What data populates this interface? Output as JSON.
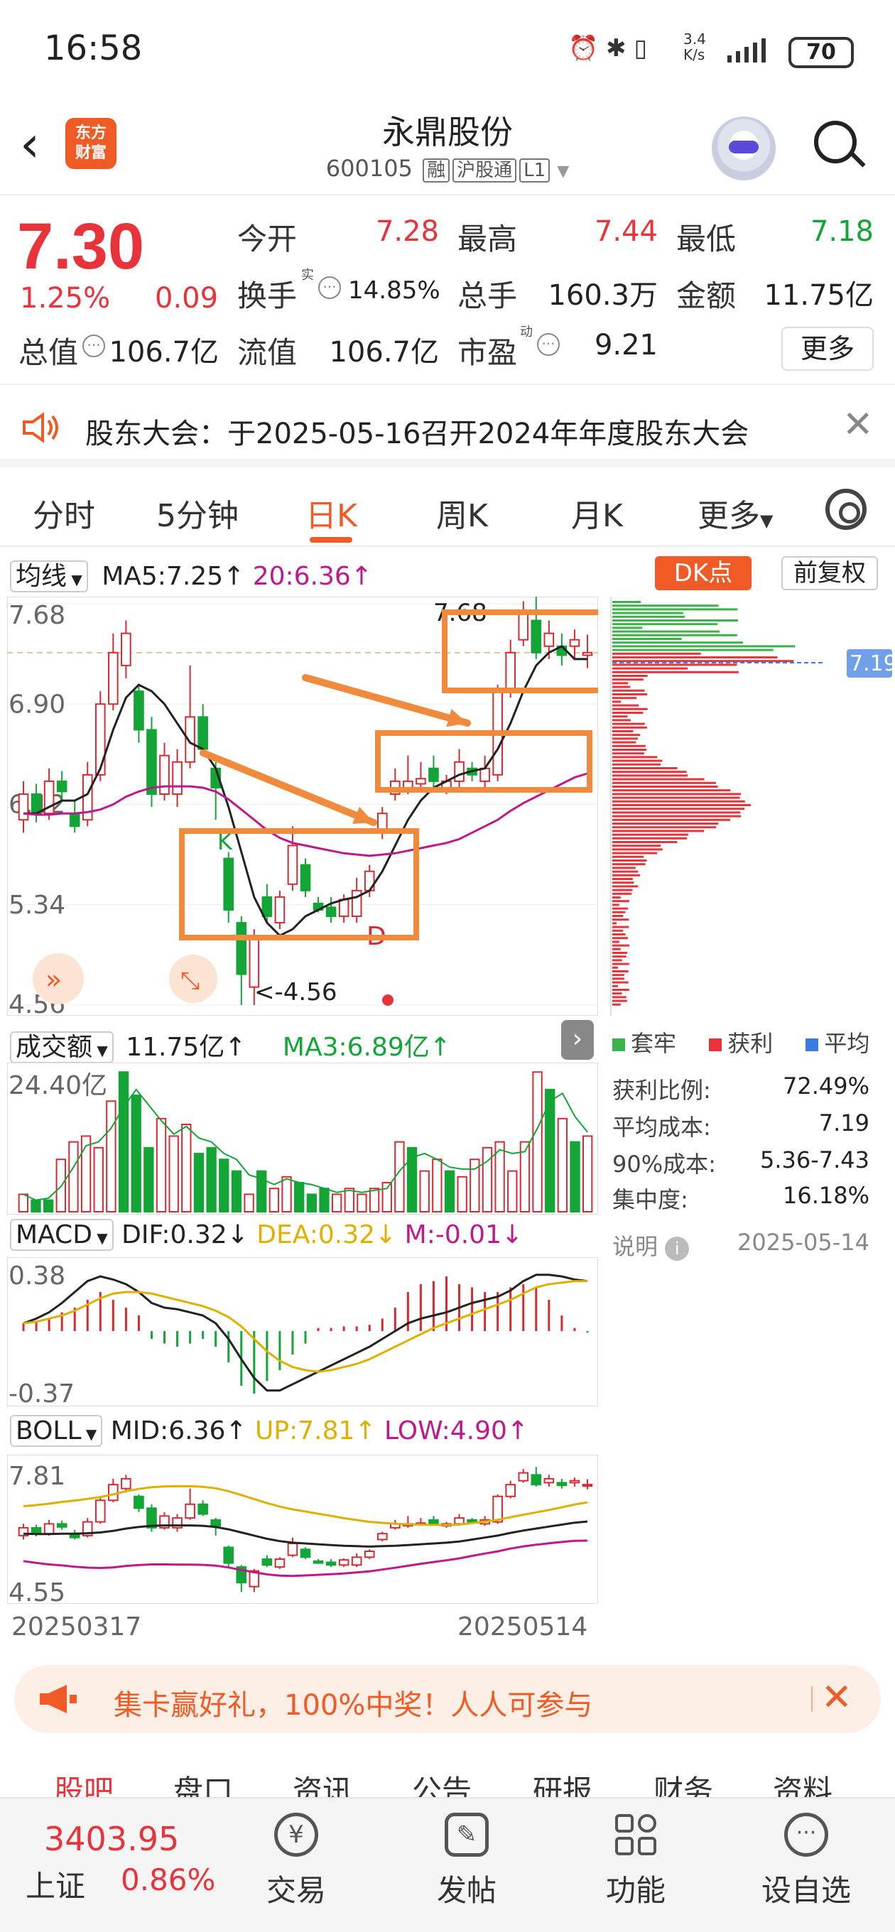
{
  "status_bar": {
    "time": "16:58",
    "net_speed": "3.4\nK/s",
    "battery": "70"
  },
  "header": {
    "logo_text": "东方\n财富",
    "stock_name": "永鼎股份",
    "stock_code": "600105",
    "tags": [
      "融",
      "沪股通",
      "L1"
    ]
  },
  "quote": {
    "price": "7.30",
    "change_pct": "1.25%",
    "change_val": "0.09",
    "fields": [
      {
        "label": "今开",
        "value": "7.28",
        "color": "#e8333a"
      },
      {
        "label": "最高",
        "value": "7.44",
        "color": "#e8333a"
      },
      {
        "label": "最低",
        "value": "7.18",
        "color": "#13a536"
      },
      {
        "label": "换手",
        "value": "14.85%",
        "color": "#222222",
        "sup": "实"
      },
      {
        "label": "总手",
        "value": "160.3万",
        "color": "#222222"
      },
      {
        "label": "金额",
        "value": "11.75亿",
        "color": "#222222"
      },
      {
        "label": "总值",
        "value": "106.7亿",
        "color": "#222222"
      },
      {
        "label": "流值",
        "value": "106.7亿",
        "color": "#222222"
      },
      {
        "label": "市盈",
        "value": "9.21",
        "color": "#222222",
        "sup": "动"
      }
    ],
    "more_label": "更多"
  },
  "notice": {
    "text": "股东大会：于2025-05-16召开2024年年度股东大会"
  },
  "tabs": [
    "分时",
    "5分钟",
    "日K",
    "周K",
    "月K",
    "更多"
  ],
  "active_tab": "日K",
  "kline_header": {
    "ma_dropdown": "均线",
    "ma5": "MA5:7.25↑",
    "ma20": "20:6.36↑",
    "dk_label": "DK点",
    "fuquan_label": "前复权"
  },
  "chart_data": [
    {
      "type": "candlestick",
      "title": "日K",
      "y_ticks": [
        "7.68",
        "6.90",
        "6.12",
        "5.34",
        "4.56"
      ],
      "ylim": [
        4.56,
        7.68
      ],
      "annotations": [
        "7.68",
        "<-4.56",
        "K",
        "D"
      ],
      "current_price_label": "7.19",
      "dates": [
        "20250317",
        "20250514"
      ],
      "candles": [
        {
          "o": 6.0,
          "c": 6.2,
          "h": 6.3,
          "l": 5.9,
          "up": true
        },
        {
          "o": 6.2,
          "c": 6.05,
          "h": 6.28,
          "l": 5.98,
          "up": false
        },
        {
          "o": 6.05,
          "c": 6.3,
          "h": 6.4,
          "l": 6.0,
          "up": true
        },
        {
          "o": 6.3,
          "c": 6.22,
          "h": 6.38,
          "l": 6.15,
          "up": false
        },
        {
          "o": 6.05,
          "c": 5.95,
          "h": 6.15,
          "l": 5.9,
          "up": false
        },
        {
          "o": 6.0,
          "c": 6.35,
          "h": 6.45,
          "l": 5.95,
          "up": true
        },
        {
          "o": 6.35,
          "c": 6.9,
          "h": 7.0,
          "l": 6.3,
          "up": true
        },
        {
          "o": 6.9,
          "c": 7.3,
          "h": 7.45,
          "l": 6.85,
          "up": true
        },
        {
          "o": 7.2,
          "c": 7.45,
          "h": 7.55,
          "l": 7.1,
          "up": true
        },
        {
          "o": 7.0,
          "c": 6.7,
          "h": 7.05,
          "l": 6.6,
          "up": false
        },
        {
          "o": 6.7,
          "c": 6.2,
          "h": 6.8,
          "l": 6.1,
          "up": false
        },
        {
          "o": 6.2,
          "c": 6.5,
          "h": 6.6,
          "l": 6.15,
          "up": true
        },
        {
          "o": 6.2,
          "c": 6.45,
          "h": 6.55,
          "l": 6.1,
          "up": true
        },
        {
          "o": 6.45,
          "c": 6.8,
          "h": 7.2,
          "l": 6.4,
          "up": true
        },
        {
          "o": 6.8,
          "c": 6.55,
          "h": 6.9,
          "l": 6.5,
          "up": false
        },
        {
          "o": 6.4,
          "c": 6.25,
          "h": 6.45,
          "l": 6.0,
          "up": false
        },
        {
          "o": 5.7,
          "c": 5.3,
          "h": 5.75,
          "l": 5.2,
          "up": false
        },
        {
          "o": 5.2,
          "c": 4.8,
          "h": 5.25,
          "l": 4.56,
          "up": false
        },
        {
          "o": 4.7,
          "c": 5.1,
          "h": 5.15,
          "l": 4.56,
          "up": true
        },
        {
          "o": 5.25,
          "c": 5.4,
          "h": 5.5,
          "l": 5.2,
          "up": false
        },
        {
          "o": 5.2,
          "c": 5.4,
          "h": 5.45,
          "l": 5.15,
          "up": true
        },
        {
          "o": 5.5,
          "c": 5.8,
          "h": 5.95,
          "l": 5.45,
          "up": true
        },
        {
          "o": 5.65,
          "c": 5.45,
          "h": 5.7,
          "l": 5.4,
          "up": false
        },
        {
          "o": 5.35,
          "c": 5.3,
          "h": 5.4,
          "l": 5.28,
          "up": false
        },
        {
          "o": 5.32,
          "c": 5.25,
          "h": 5.4,
          "l": 5.2,
          "up": false
        },
        {
          "o": 5.25,
          "c": 5.38,
          "h": 5.42,
          "l": 5.2,
          "up": true
        },
        {
          "o": 5.25,
          "c": 5.45,
          "h": 5.55,
          "l": 5.2,
          "up": true
        },
        {
          "o": 5.45,
          "c": 5.6,
          "h": 5.65,
          "l": 5.4,
          "up": true
        },
        {
          "o": 5.9,
          "c": 6.05,
          "h": 6.1,
          "l": 5.85,
          "up": true
        },
        {
          "o": 6.2,
          "c": 6.3,
          "h": 6.4,
          "l": 6.15,
          "up": true
        },
        {
          "o": 6.25,
          "c": 6.3,
          "h": 6.5,
          "l": 6.2,
          "up": true
        },
        {
          "o": 6.28,
          "c": 6.32,
          "h": 6.45,
          "l": 6.25,
          "up": true
        },
        {
          "o": 6.4,
          "c": 6.3,
          "h": 6.5,
          "l": 6.25,
          "up": false
        },
        {
          "o": 6.25,
          "c": 6.3,
          "h": 6.35,
          "l": 6.2,
          "up": true
        },
        {
          "o": 6.3,
          "c": 6.45,
          "h": 6.55,
          "l": 6.25,
          "up": true
        },
        {
          "o": 6.4,
          "c": 6.35,
          "h": 6.45,
          "l": 6.3,
          "up": false
        },
        {
          "o": 6.3,
          "c": 6.4,
          "h": 6.5,
          "l": 6.25,
          "up": true
        },
        {
          "o": 6.35,
          "c": 7.0,
          "h": 7.05,
          "l": 6.3,
          "up": true
        },
        {
          "o": 7.0,
          "c": 7.3,
          "h": 7.4,
          "l": 6.95,
          "up": true
        },
        {
          "o": 7.4,
          "c": 7.6,
          "h": 7.7,
          "l": 7.35,
          "up": true
        },
        {
          "o": 7.55,
          "c": 7.3,
          "h": 7.75,
          "l": 7.25,
          "up": false
        },
        {
          "o": 7.35,
          "c": 7.45,
          "h": 7.55,
          "l": 7.25,
          "up": true
        },
        {
          "o": 7.35,
          "c": 7.28,
          "h": 7.45,
          "l": 7.2,
          "up": false
        },
        {
          "o": 7.35,
          "c": 7.4,
          "h": 7.48,
          "l": 7.25,
          "up": true
        },
        {
          "o": 7.28,
          "c": 7.3,
          "h": 7.44,
          "l": 7.18,
          "up": true
        }
      ],
      "ma5": [
        6.05,
        6.05,
        6.1,
        6.15,
        6.15,
        6.2,
        6.4,
        6.7,
        6.95,
        7.05,
        7.0,
        6.9,
        6.75,
        6.6,
        6.55,
        6.4,
        6.1,
        5.75,
        5.4,
        5.2,
        5.1,
        5.15,
        5.25,
        5.3,
        5.35,
        5.38,
        5.4,
        5.45,
        5.6,
        5.8,
        6.0,
        6.15,
        6.25,
        6.3,
        6.35,
        6.38,
        6.4,
        6.55,
        6.75,
        7.0,
        7.2,
        7.3,
        7.35,
        7.25,
        7.25
      ],
      "ma20": [
        6.05,
        6.04,
        6.04,
        6.05,
        6.05,
        6.06,
        6.08,
        6.12,
        6.18,
        6.22,
        6.25,
        6.26,
        6.26,
        6.26,
        6.25,
        6.22,
        6.16,
        6.08,
        6.0,
        5.92,
        5.86,
        5.82,
        5.8,
        5.78,
        5.76,
        5.74,
        5.73,
        5.72,
        5.73,
        5.74,
        5.76,
        5.78,
        5.8,
        5.82,
        5.85,
        5.9,
        5.95,
        6.0,
        6.07,
        6.13,
        6.18,
        6.23,
        6.28,
        6.33,
        6.36
      ]
    },
    {
      "type": "bar",
      "title": "成交额",
      "value_label": "11.75亿↑",
      "ma3_label": "MA3:6.89亿↑",
      "y_tick": "24.40亿",
      "values": [
        3,
        2,
        2,
        9,
        12,
        13,
        11,
        19,
        24,
        20,
        11,
        16,
        13,
        15,
        10,
        11,
        9,
        7,
        3,
        7,
        4,
        6,
        5,
        3,
        4,
        3,
        4,
        3,
        4,
        5,
        12,
        11,
        7,
        9,
        7,
        6,
        9,
        11,
        12,
        7,
        12,
        24,
        21,
        16,
        12,
        13
      ],
      "up": [
        true,
        false,
        false,
        true,
        true,
        true,
        true,
        true,
        false,
        false,
        false,
        true,
        true,
        true,
        false,
        false,
        false,
        false,
        true,
        false,
        true,
        true,
        false,
        false,
        false,
        true,
        true,
        true,
        true,
        true,
        true,
        false,
        true,
        true,
        false,
        true,
        true,
        true,
        true,
        true,
        true,
        true,
        false,
        true,
        false,
        true
      ]
    },
    {
      "type": "bar",
      "title": "MACD",
      "dif_label": "DIF:0.32↓",
      "dea_label": "DEA:0.32↓",
      "m_label": "M:-0.01↓",
      "y_ticks": [
        "0.38",
        "-0.37"
      ],
      "hist": [
        0.05,
        0.06,
        0.08,
        0.12,
        0.15,
        0.2,
        0.25,
        0.2,
        0.15,
        0.1,
        -0.05,
        -0.08,
        -0.1,
        -0.08,
        -0.05,
        -0.1,
        -0.2,
        -0.35,
        -0.4,
        -0.32,
        -0.25,
        -0.15,
        -0.08,
        0.02,
        0.02,
        0.03,
        0.03,
        0.04,
        0.08,
        0.15,
        0.25,
        0.3,
        0.32,
        0.35,
        0.3,
        0.28,
        0.25,
        0.25,
        0.28,
        0.3,
        0.28,
        0.2,
        0.1,
        0.02,
        -0.01
      ],
      "dif": [
        0.05,
        0.08,
        0.12,
        0.18,
        0.25,
        0.32,
        0.35,
        0.33,
        0.3,
        0.25,
        0.18,
        0.15,
        0.14,
        0.12,
        0.1,
        0.05,
        -0.05,
        -0.18,
        -0.3,
        -0.38,
        -0.38,
        -0.34,
        -0.3,
        -0.26,
        -0.22,
        -0.18,
        -0.14,
        -0.1,
        -0.05,
        0.0,
        0.05,
        0.08,
        0.1,
        0.12,
        0.15,
        0.18,
        0.2,
        0.22,
        0.26,
        0.32,
        0.36,
        0.36,
        0.35,
        0.33,
        0.32
      ],
      "dea": [
        0.05,
        0.06,
        0.08,
        0.1,
        0.13,
        0.17,
        0.21,
        0.24,
        0.25,
        0.25,
        0.24,
        0.22,
        0.2,
        0.18,
        0.16,
        0.13,
        0.09,
        0.03,
        -0.05,
        -0.13,
        -0.19,
        -0.23,
        -0.25,
        -0.26,
        -0.25,
        -0.23,
        -0.21,
        -0.18,
        -0.14,
        -0.1,
        -0.06,
        -0.02,
        0.02,
        0.05,
        0.08,
        0.11,
        0.14,
        0.17,
        0.2,
        0.24,
        0.28,
        0.3,
        0.31,
        0.32,
        0.32
      ]
    },
    {
      "type": "line",
      "title": "BOLL",
      "mid_label": "MID:6.36↑",
      "up_label": "UP:7.81↑",
      "low_label": "LOW:4.90↑",
      "y_ticks": [
        "7.81",
        "4.55"
      ],
      "dates": [
        "20250317",
        "20250514"
      ]
    }
  ],
  "chip_distribution": {
    "legend": [
      {
        "label": "套牢",
        "color": "#3bb34a"
      },
      {
        "label": "获利",
        "color": "#e8333a"
      },
      {
        "label": "平均",
        "color": "#3a7be0"
      }
    ],
    "stats": [
      {
        "label": "获利比例:",
        "value": "72.49%"
      },
      {
        "label": "平均成本:",
        "value": "7.19"
      },
      {
        "label": "90%成本:",
        "value": "5.36-7.43"
      },
      {
        "label": "集中度:",
        "value": "16.18%"
      }
    ],
    "note_label": "说明",
    "date": "2025-05-14"
  },
  "promo": {
    "text": "集卡赢好礼，100%中奖！人人可参与"
  },
  "sub_tabs": [
    "股吧",
    "盘口",
    "资讯",
    "公告",
    "研报",
    "财务",
    "资料"
  ],
  "bottom_nav": {
    "index_value": "3403.95",
    "index_name": "上证",
    "index_pct": "0.86%",
    "items": [
      "交易",
      "发帖",
      "功能",
      "设自选"
    ]
  }
}
